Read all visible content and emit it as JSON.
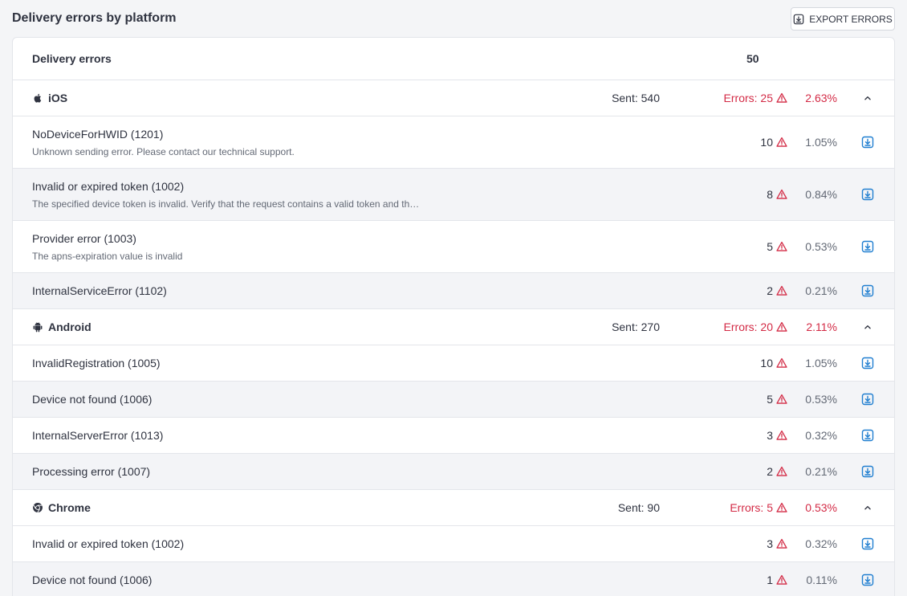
{
  "header": {
    "title": "Delivery errors by platform",
    "export_label": "EXPORT ERRORS"
  },
  "summary": {
    "label": "Delivery errors",
    "value": "50"
  },
  "colors": {
    "error_red": "#d32a45",
    "action_blue": "#1f7ed0"
  },
  "platforms": [
    {
      "name": "iOS",
      "icon": "apple-icon",
      "sent": "Sent: 540",
      "errors": "Errors: 25",
      "percent": "2.63%",
      "rows": [
        {
          "title": "NoDeviceForHWID (1201)",
          "desc": "Unknown sending error. Please contact our technical support.",
          "count": "10",
          "percent": "1.05%"
        },
        {
          "title": "Invalid or expired token (1002)",
          "desc": "The specified device token is invalid. Verify that the request contains a valid token and th…",
          "count": "8",
          "percent": "0.84%"
        },
        {
          "title": "Provider error (1003)",
          "desc": "The apns-expiration value is invalid",
          "count": "5",
          "percent": "0.53%"
        },
        {
          "title": "InternalServiceError (1102)",
          "desc": "",
          "count": "2",
          "percent": "0.21%"
        }
      ]
    },
    {
      "name": "Android",
      "icon": "android-icon",
      "sent": "Sent: 270",
      "errors": "Errors: 20",
      "percent": "2.11%",
      "rows": [
        {
          "title": "InvalidRegistration (1005)",
          "desc": "",
          "count": "10",
          "percent": "1.05%"
        },
        {
          "title": "Device not found (1006)",
          "desc": "",
          "count": "5",
          "percent": "0.53%"
        },
        {
          "title": "InternalServerError (1013)",
          "desc": "",
          "count": "3",
          "percent": "0.32%"
        },
        {
          "title": "Processing error (1007)",
          "desc": "",
          "count": "2",
          "percent": "0.21%"
        }
      ]
    },
    {
      "name": "Chrome",
      "icon": "chrome-icon",
      "sent": "Sent: 90",
      "errors": "Errors: 5",
      "percent": "0.53%",
      "rows": [
        {
          "title": "Invalid or expired token (1002)",
          "desc": "",
          "count": "3",
          "percent": "0.32%"
        },
        {
          "title": "Device not found (1006)",
          "desc": "",
          "count": "1",
          "percent": "0.11%"
        }
      ]
    }
  ]
}
